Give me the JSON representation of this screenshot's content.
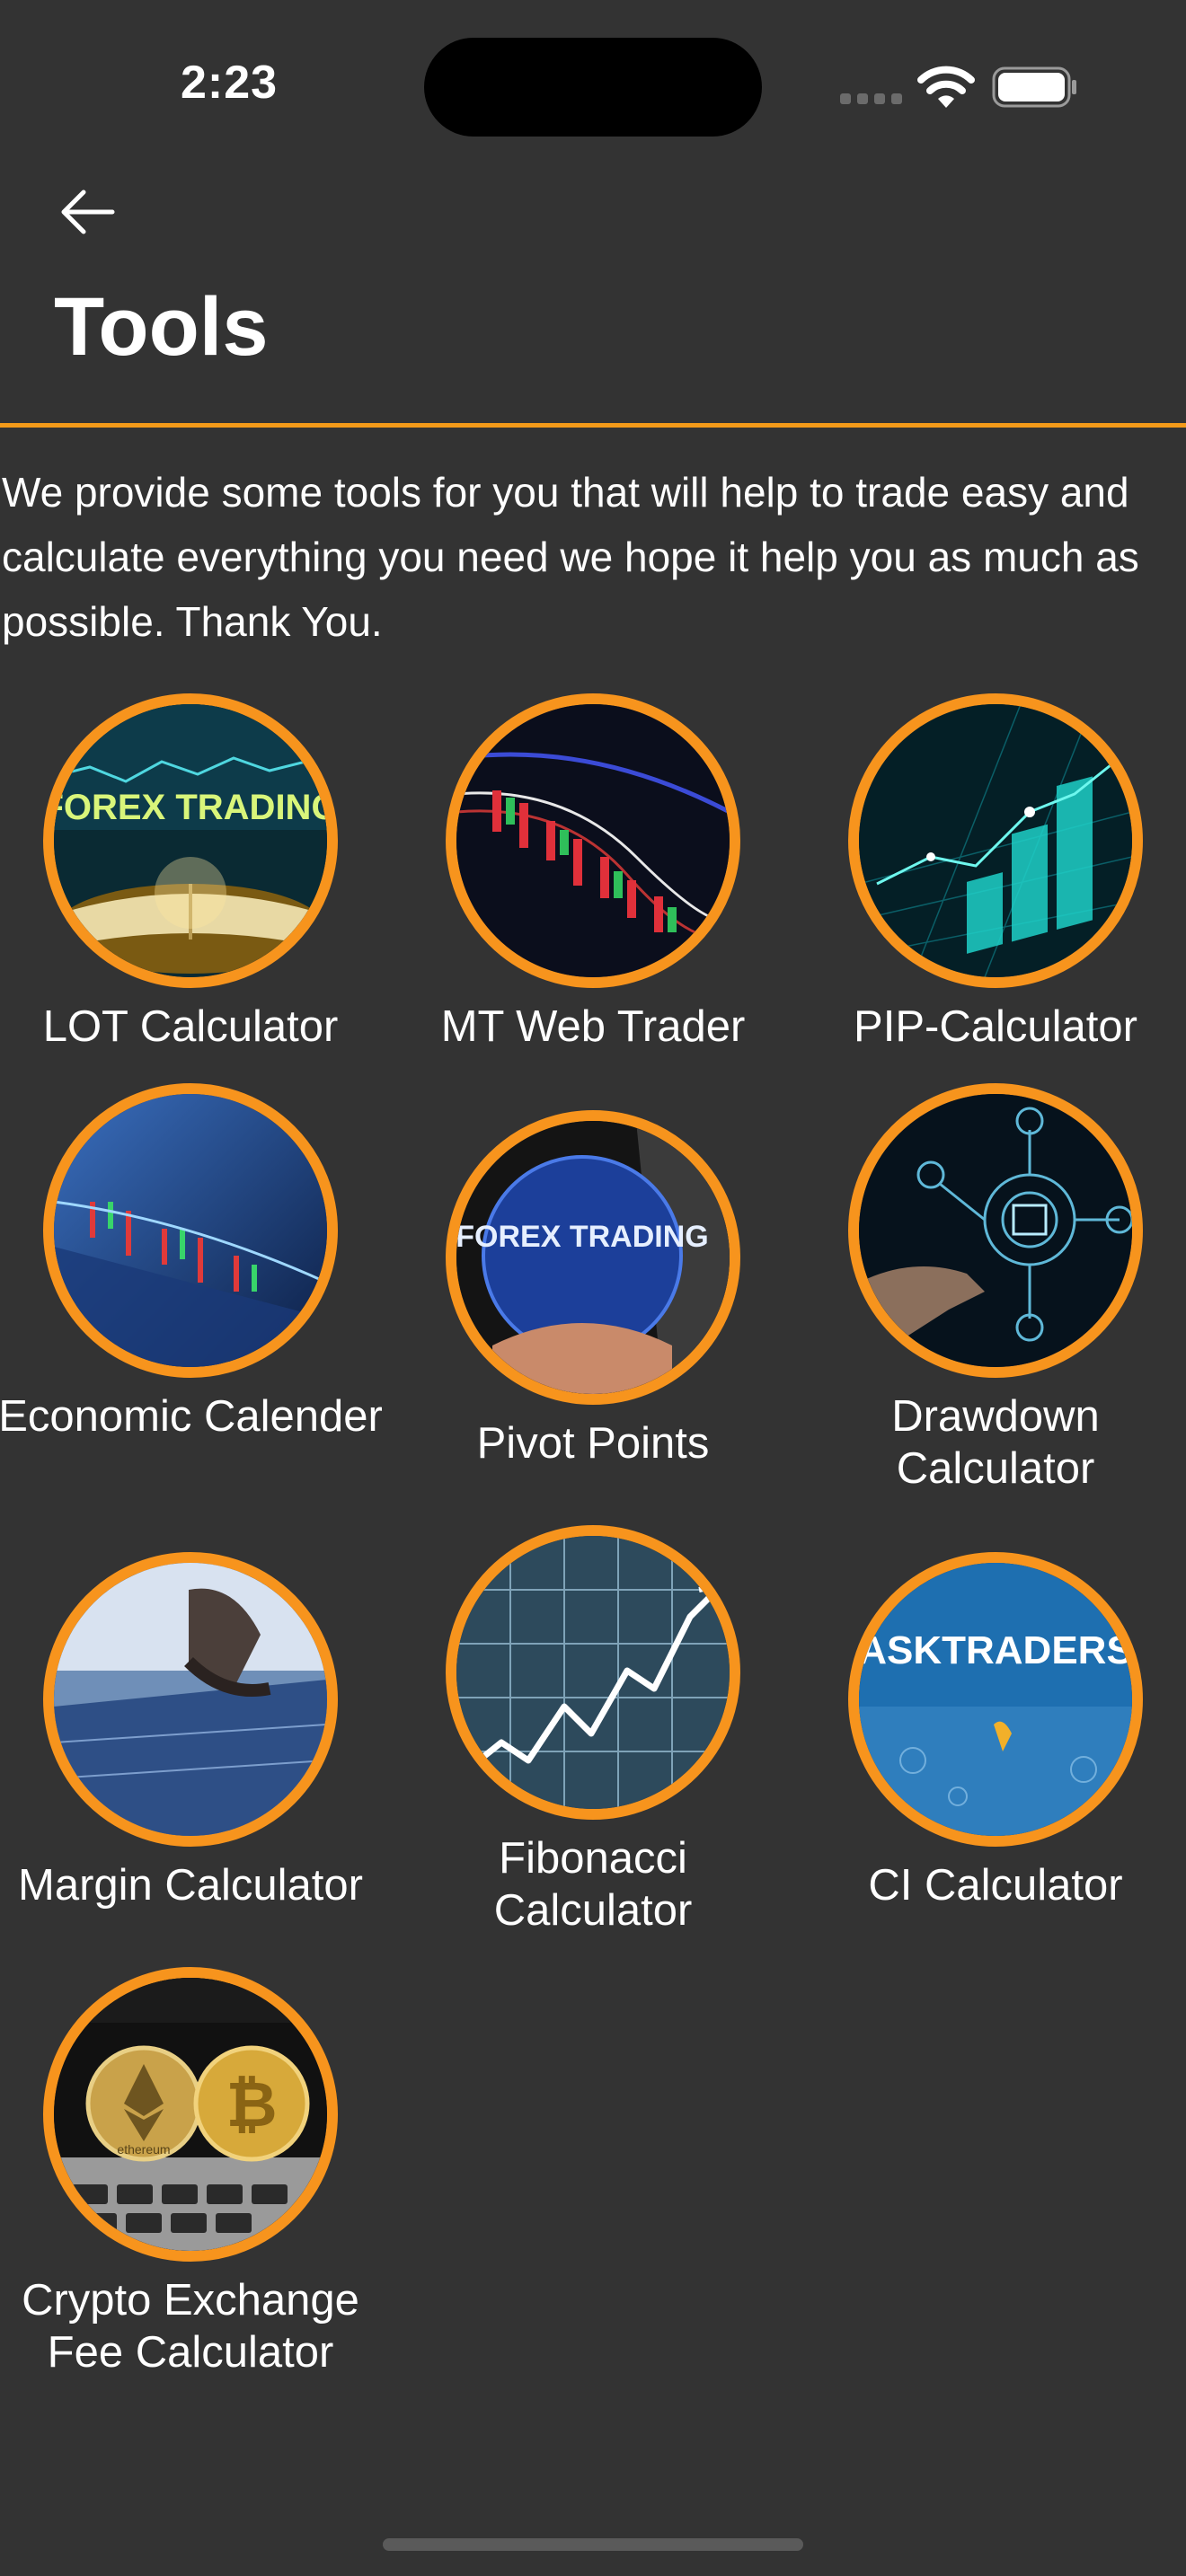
{
  "status_bar": {
    "time": "2:23",
    "icons": [
      "signal-icon",
      "wifi-icon",
      "battery-icon"
    ]
  },
  "header": {
    "back_icon": "arrow-left-icon",
    "title": "Tools"
  },
  "intro": {
    "text": "We provide some tools for you that will help to trade easy and calculate everything you need we hope it help you as much as possible. Thank You."
  },
  "colors": {
    "background": "#333333",
    "accent": "#f7941d",
    "text": "#ffffff"
  },
  "tools": [
    {
      "label": "LOT Calculator",
      "image_text": "FOREX TRADING"
    },
    {
      "label": "MT Web Trader"
    },
    {
      "label": "PIP-Calculator"
    },
    {
      "label": "Economic Calender"
    },
    {
      "label": "Pivot Points",
      "image_text": "FOREX TRADING"
    },
    {
      "label": "Drawdown Calculator"
    },
    {
      "label": "Margin Calculator"
    },
    {
      "label": "Fibonacci Calculator"
    },
    {
      "label": "CI Calculator",
      "image_text": "ASKTRADERS"
    },
    {
      "label": "Crypto Exchange Fee Calculator",
      "image_text": "ethereum"
    }
  ]
}
